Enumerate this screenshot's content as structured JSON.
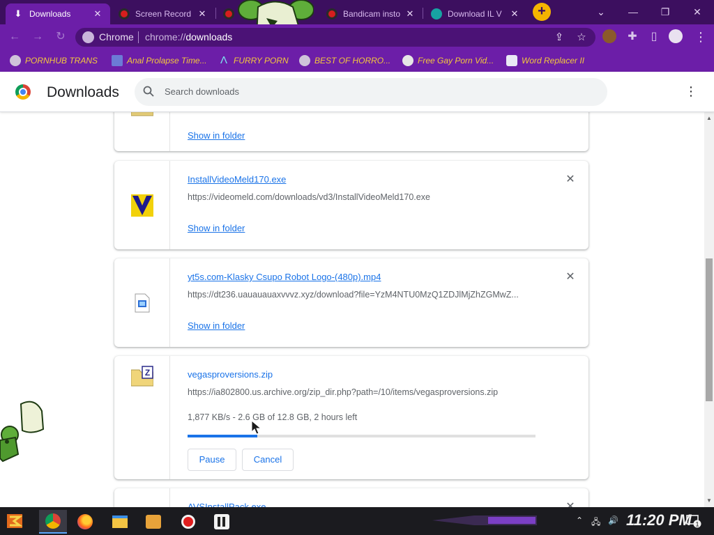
{
  "tabs": [
    {
      "title": "Downloads",
      "icon": "download-icon",
      "active": true
    },
    {
      "title": "Screen Record",
      "icon": "record-icon",
      "active": false
    },
    {
      "title": "",
      "icon": "record-icon",
      "active": false
    },
    {
      "title": "Bandicam insto",
      "icon": "record-icon",
      "active": false
    },
    {
      "title": "Download IL V",
      "icon": "il-icon",
      "active": false
    }
  ],
  "tab_close_glyph": "✕",
  "new_tab_glyph": "+",
  "window_controls": {
    "down": "⌄",
    "minimize": "—",
    "restore": "❐",
    "close": "✕"
  },
  "toolbar": {
    "site_label": "Chrome",
    "url_prefix": "chrome://",
    "url_page": "downloads"
  },
  "bookmarks": [
    {
      "label": "PORNHUB TRANS",
      "icon": "globe-icon"
    },
    {
      "label": "Anal Prolapse Time...",
      "icon": "bookmark-icon"
    },
    {
      "label": "FURRY PORN",
      "icon": "a-logo-icon"
    },
    {
      "label": "BEST OF HORRO...",
      "icon": "globe-icon"
    },
    {
      "label": "Free Gay Porn Vid...",
      "icon": "site-icon"
    },
    {
      "label": "Word Replacer II",
      "icon": "wr-icon"
    }
  ],
  "header": {
    "title": "Downloads",
    "search_placeholder": "Search downloads"
  },
  "downloads": [
    {
      "name": "",
      "url": "",
      "action": "Show in folder",
      "icon": "archive-folder-icon"
    },
    {
      "name": "InstallVideoMeld170.exe",
      "url": "https://videomeld.com/downloads/vd3/InstallVideoMeld170.exe",
      "action": "Show in folder",
      "icon": "videomeld-logo-icon"
    },
    {
      "name": "yt5s.com-Klasky Csupo Robot Logo-(480p).mp4",
      "url": "https://dt236.uauauauaxvvvz.xyz/download?file=YzM4NTU0MzQ1ZDJlMjZhZGMwZ...",
      "action": "Show in folder",
      "icon": "video-file-icon"
    },
    {
      "name": "vegasproversions.zip",
      "url": "https://ia802800.us.archive.org/zip_dir.php?path=/10/items/vegasproversions.zip",
      "progress_text": "1,877 KB/s - 2.6 GB of 12.8 GB, 2 hours left",
      "progress_fraction": 0.2,
      "pause_label": "Pause",
      "cancel_label": "Cancel",
      "icon": "zip-folder-icon"
    },
    {
      "name": "AVSInstallPack.exe",
      "icon": "exe-file-icon"
    }
  ],
  "taskbar": {
    "clock": "11:20 PM",
    "notification_count": "1",
    "apps": [
      "chrome-icon",
      "firefox-icon",
      "file-explorer-icon",
      "media-player-icon",
      "bandicam-icon",
      "il-app-icon"
    ]
  },
  "colors": {
    "tabstrip": "#3c0f5f",
    "toolbar": "#6c1ea8",
    "bookmark_text": "#f4c83c",
    "link": "#1a73e8",
    "new_tab": "#f5b400"
  }
}
